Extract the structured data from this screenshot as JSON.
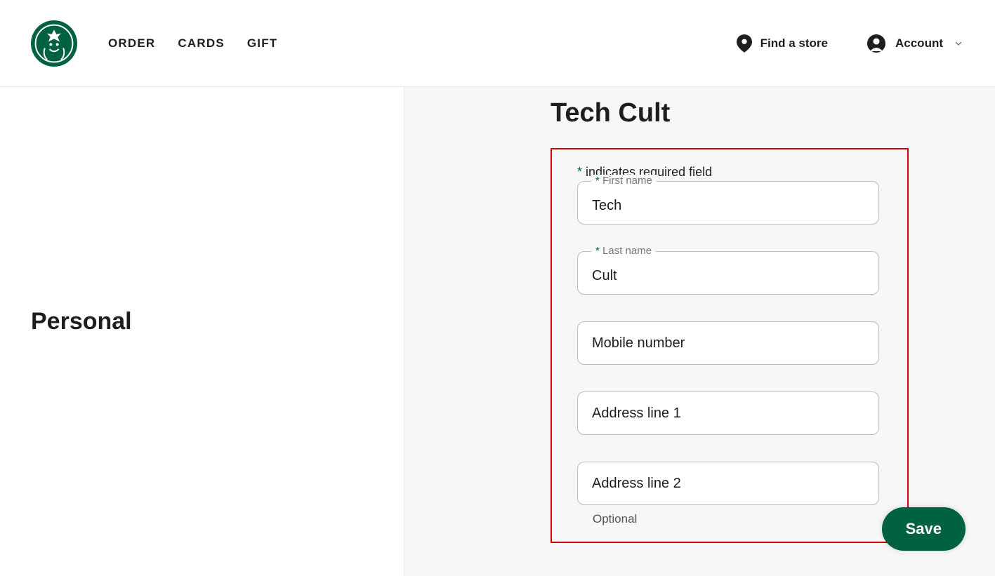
{
  "header": {
    "nav": {
      "order": "Order",
      "cards": "Cards",
      "gift": "Gift"
    },
    "find_store": "Find a store",
    "account": "Account"
  },
  "sidebar": {
    "title": "Personal"
  },
  "main": {
    "page_title": "Tech Cult",
    "required_note_prefix": "*",
    "required_note": " indicates required field",
    "fields": {
      "first_name": {
        "label_prefix": "* ",
        "label": "First name",
        "value": "Tech"
      },
      "last_name": {
        "label_prefix": "* ",
        "label": "Last name",
        "value": "Cult"
      },
      "mobile": {
        "placeholder": "Mobile number"
      },
      "addr1": {
        "placeholder": "Address line 1"
      },
      "addr2": {
        "placeholder": "Address line 2",
        "helper": "Optional"
      }
    },
    "save_label": "Save"
  }
}
